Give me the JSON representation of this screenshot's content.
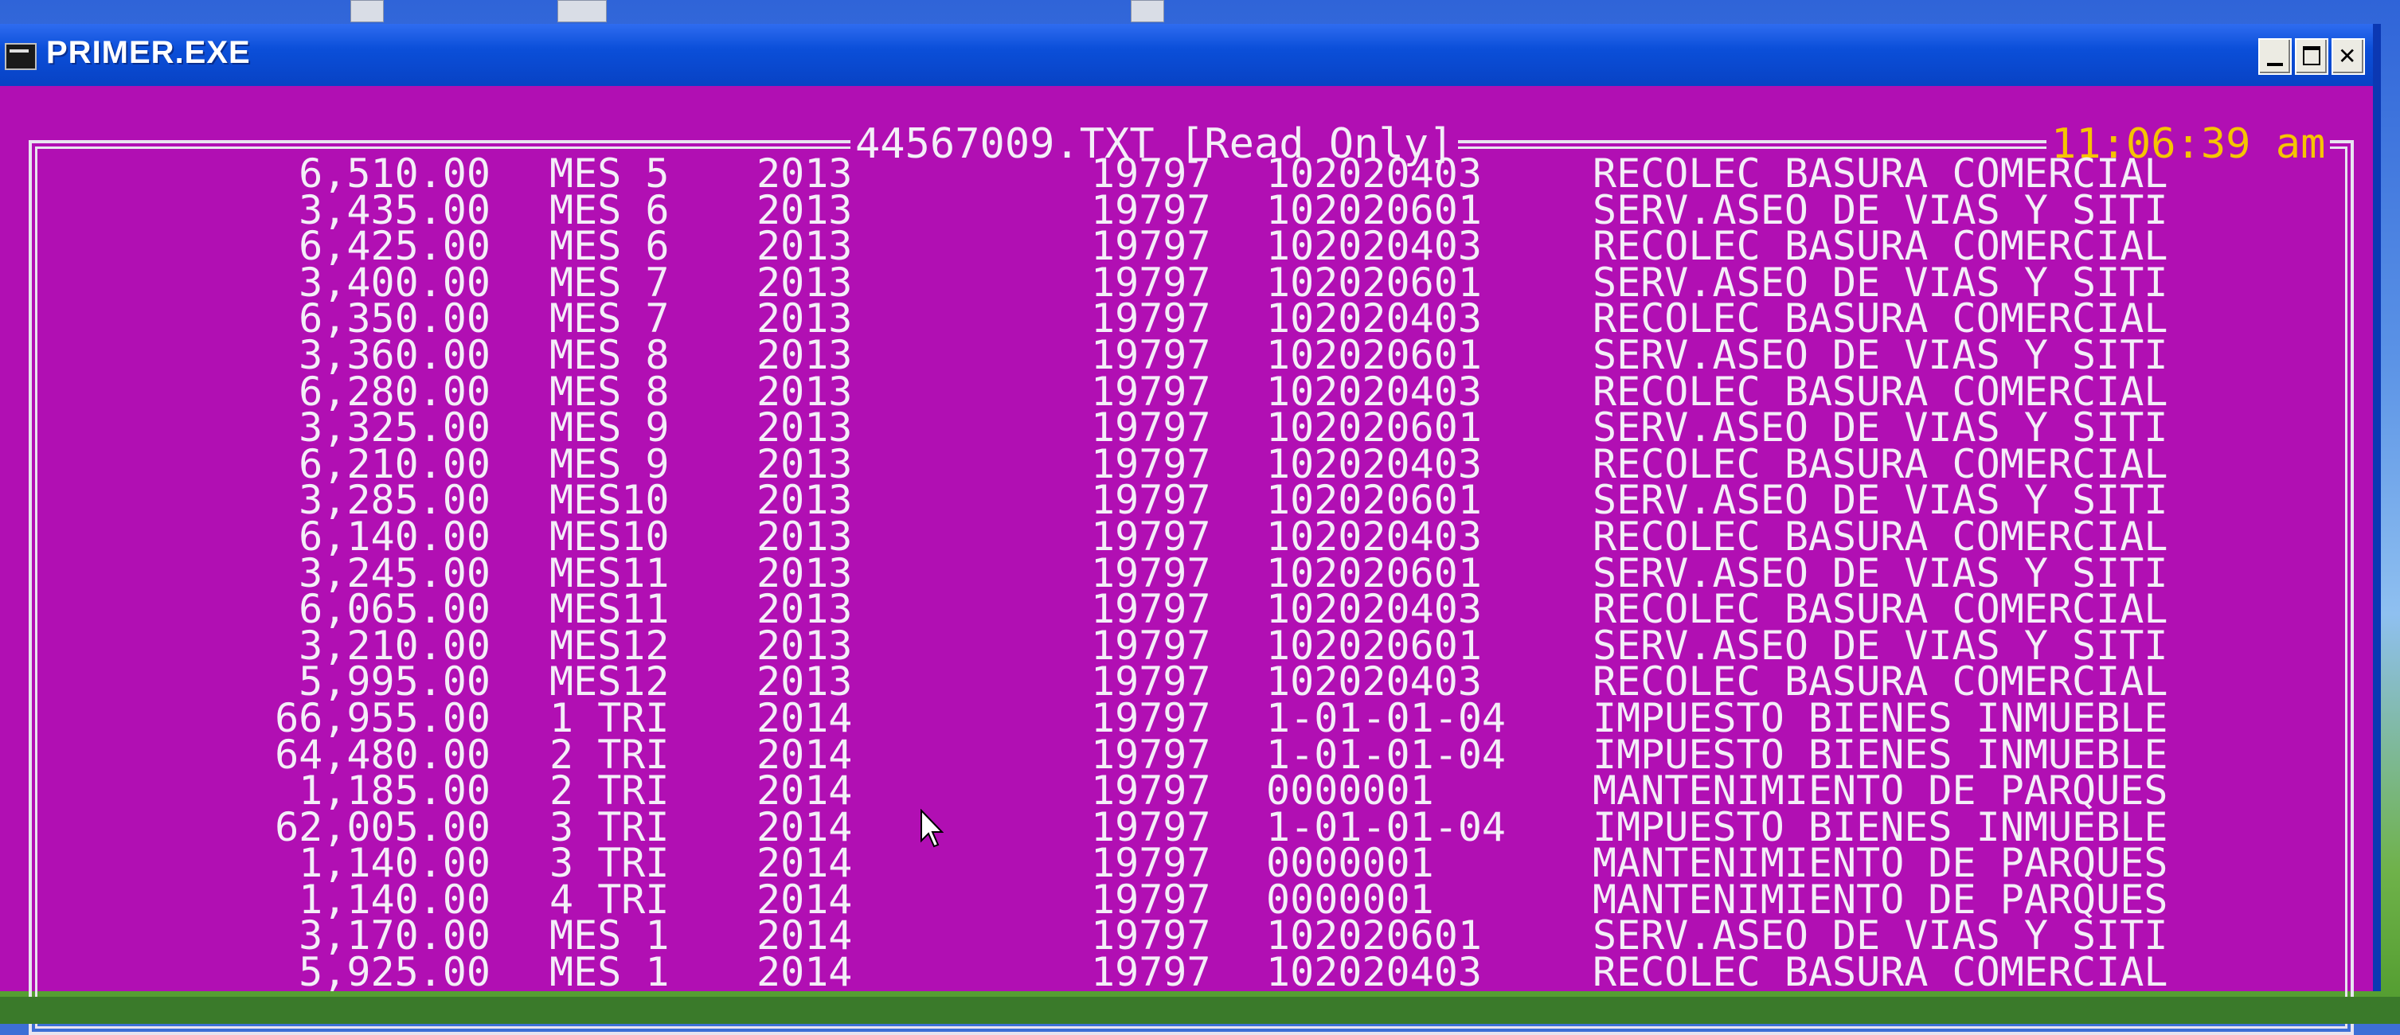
{
  "window": {
    "title": "PRIMER.EXE"
  },
  "console": {
    "file_title": "44567009.TXT [Read Only]",
    "clock": "11:06:39 am",
    "rows": [
      {
        "amount": "6,510.00",
        "period": "MES 5",
        "year": "2013",
        "code": "19797",
        "account": "102020403",
        "description": "RECOLEC BASURA COMERCIAL"
      },
      {
        "amount": "3,435.00",
        "period": "MES 6",
        "year": "2013",
        "code": "19797",
        "account": "102020601",
        "description": "SERV.ASEO DE VIAS Y SITI"
      },
      {
        "amount": "6,425.00",
        "period": "MES 6",
        "year": "2013",
        "code": "19797",
        "account": "102020403",
        "description": "RECOLEC BASURA COMERCIAL"
      },
      {
        "amount": "3,400.00",
        "period": "MES 7",
        "year": "2013",
        "code": "19797",
        "account": "102020601",
        "description": "SERV.ASEO DE VIAS Y SITI"
      },
      {
        "amount": "6,350.00",
        "period": "MES 7",
        "year": "2013",
        "code": "19797",
        "account": "102020403",
        "description": "RECOLEC BASURA COMERCIAL"
      },
      {
        "amount": "3,360.00",
        "period": "MES 8",
        "year": "2013",
        "code": "19797",
        "account": "102020601",
        "description": "SERV.ASEO DE VIAS Y SITI"
      },
      {
        "amount": "6,280.00",
        "period": "MES 8",
        "year": "2013",
        "code": "19797",
        "account": "102020403",
        "description": "RECOLEC BASURA COMERCIAL"
      },
      {
        "amount": "3,325.00",
        "period": "MES 9",
        "year": "2013",
        "code": "19797",
        "account": "102020601",
        "description": "SERV.ASEO DE VIAS Y SITI"
      },
      {
        "amount": "6,210.00",
        "period": "MES 9",
        "year": "2013",
        "code": "19797",
        "account": "102020403",
        "description": "RECOLEC BASURA COMERCIAL"
      },
      {
        "amount": "3,285.00",
        "period": "MES10",
        "year": "2013",
        "code": "19797",
        "account": "102020601",
        "description": "SERV.ASEO DE VIAS Y SITI"
      },
      {
        "amount": "6,140.00",
        "period": "MES10",
        "year": "2013",
        "code": "19797",
        "account": "102020403",
        "description": "RECOLEC BASURA COMERCIAL"
      },
      {
        "amount": "3,245.00",
        "period": "MES11",
        "year": "2013",
        "code": "19797",
        "account": "102020601",
        "description": "SERV.ASEO DE VIAS Y SITI"
      },
      {
        "amount": "6,065.00",
        "period": "MES11",
        "year": "2013",
        "code": "19797",
        "account": "102020403",
        "description": "RECOLEC BASURA COMERCIAL"
      },
      {
        "amount": "3,210.00",
        "period": "MES12",
        "year": "2013",
        "code": "19797",
        "account": "102020601",
        "description": "SERV.ASEO DE VIAS Y SITI"
      },
      {
        "amount": "5,995.00",
        "period": "MES12",
        "year": "2013",
        "code": "19797",
        "account": "102020403",
        "description": "RECOLEC BASURA COMERCIAL"
      },
      {
        "amount": "66,955.00",
        "period": "1 TRI",
        "year": "2014",
        "code": "19797",
        "account": "1-01-01-04",
        "description": "IMPUESTO BIENES INMUEBLE"
      },
      {
        "amount": "64,480.00",
        "period": "2 TRI",
        "year": "2014",
        "code": "19797",
        "account": "1-01-01-04",
        "description": "IMPUESTO BIENES INMUEBLE"
      },
      {
        "amount": "1,185.00",
        "period": "2 TRI",
        "year": "2014",
        "code": "19797",
        "account": "0000001",
        "description": "MANTENIMIENTO DE PARQUES"
      },
      {
        "amount": "62,005.00",
        "period": "3 TRI",
        "year": "2014",
        "code": "19797",
        "account": "1-01-01-04",
        "description": "IMPUESTO BIENES INMUEBLE"
      },
      {
        "amount": "1,140.00",
        "period": "3 TRI",
        "year": "2014",
        "code": "19797",
        "account": "0000001",
        "description": "MANTENIMIENTO DE PARQUES"
      },
      {
        "amount": "1,140.00",
        "period": "4 TRI",
        "year": "2014",
        "code": "19797",
        "account": "0000001",
        "description": "MANTENIMIENTO DE PARQUES"
      },
      {
        "amount": "3,170.00",
        "period": "MES 1",
        "year": "2014",
        "code": "19797",
        "account": "102020601",
        "description": "SERV.ASEO DE VIAS Y SITI"
      },
      {
        "amount": "5,925.00",
        "period": "MES 1",
        "year": "2014",
        "code": "19797",
        "account": "102020403",
        "description": "RECOLEC BASURA COMERCIAL"
      }
    ]
  },
  "colors": {
    "console_background": "#b10fb3",
    "console_text": "#f4eef8",
    "clock_text": "#f6c400",
    "title_bar": "#0b4fd9"
  },
  "icons": {
    "app": "console-app-icon",
    "minimize": "minimize-icon",
    "maximize": "maximize-icon",
    "close": "close-icon",
    "cursor": "mouse-pointer-icon"
  }
}
